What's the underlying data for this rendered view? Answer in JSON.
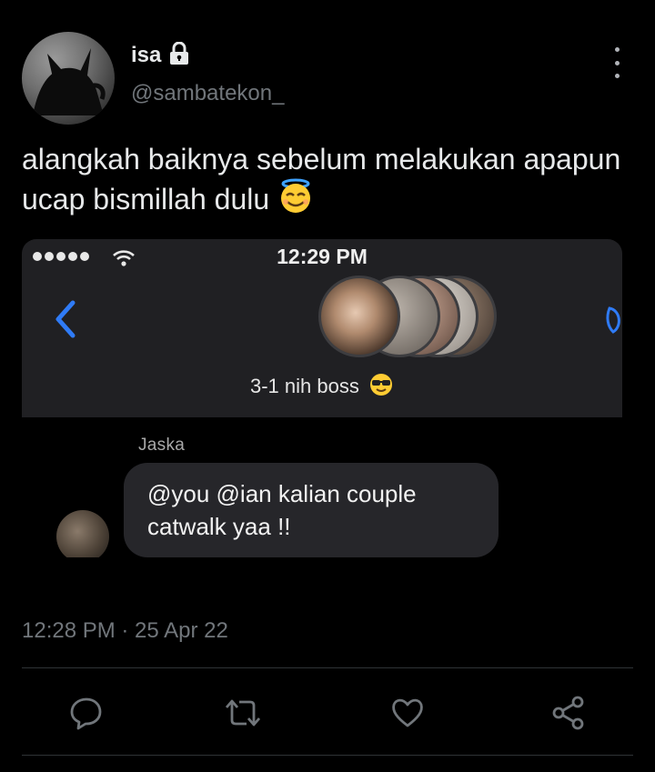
{
  "author": {
    "display_name": "isa",
    "handle": "@sambatekon_",
    "protected_icon": "lock-icon"
  },
  "tweet": {
    "text": "alangkah baiknya sebelum melakukan apapun ucap bismillah dulu",
    "emoji": "smiling-face-with-halo",
    "timestamp": "12:28 PM · 25 Apr 22"
  },
  "screenshot": {
    "status_time": "12:29 PM",
    "group_name": "3-1 nih boss",
    "group_emoji": "smiling-face-with-sunglasses",
    "sender": "Jaska",
    "message": "@you @ian kalian couple catwalk yaa !!"
  },
  "actions": [
    "reply-icon",
    "retweet-icon",
    "like-icon",
    "share-icon"
  ],
  "colors": {
    "background": "#000000",
    "text": "#e7e9ea",
    "secondary": "#71767b",
    "bubble": "#26262a",
    "ios_blue": "#2f7bf6"
  }
}
